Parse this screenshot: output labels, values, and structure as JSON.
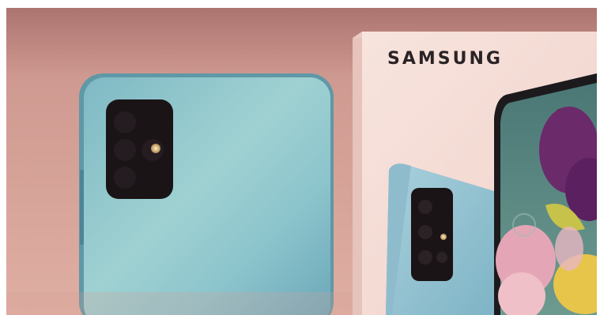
{
  "scene": {
    "brand_text": "SAMSUNG",
    "subjects": [
      "smartphone-back",
      "product-box"
    ],
    "colors": {
      "wall": "#d9a79c",
      "wall_shadow": "#b57f79",
      "phone_body": "#8fc6cf",
      "phone_edge": "#5f98a6",
      "camera_module": "#1a1417",
      "box_face": "#f4ddd6",
      "screen_teal": "#4f7f7e",
      "flower_purple": "#6b2a6a",
      "petal_pink": "#e4a6b6",
      "petal_yellow": "#e7c54a"
    }
  }
}
